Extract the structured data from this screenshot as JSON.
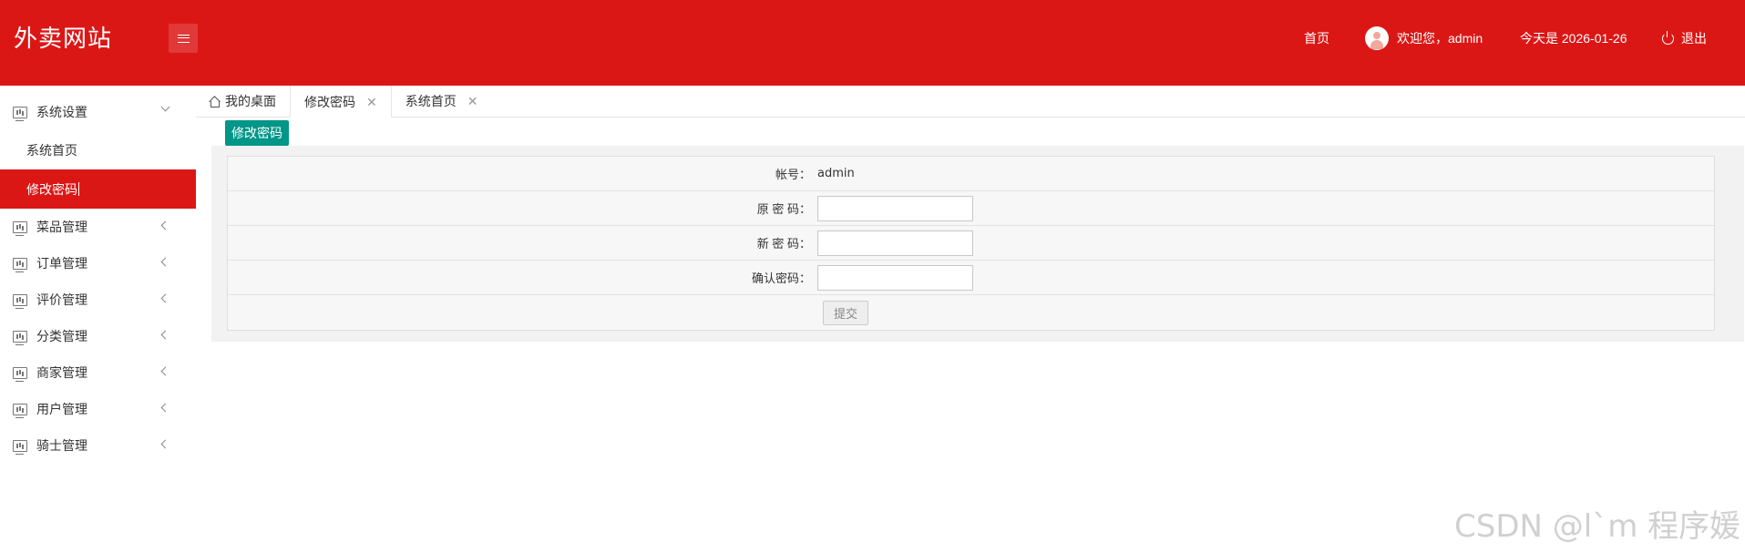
{
  "header": {
    "logo": "外卖网站",
    "nav_home": "首页",
    "welcome": "欢迎您，admin",
    "date_text": "今天是 2026-01-26",
    "logout": "退出"
  },
  "sidebar": {
    "items": [
      {
        "label": "系统设置",
        "expanded": true,
        "children": [
          "系统首页",
          "修改密码"
        ]
      },
      {
        "label": "菜品管理"
      },
      {
        "label": "订单管理"
      },
      {
        "label": "评价管理"
      },
      {
        "label": "分类管理"
      },
      {
        "label": "商家管理"
      },
      {
        "label": "用户管理"
      },
      {
        "label": "骑士管理"
      }
    ],
    "active_child": "修改密码"
  },
  "tabs": [
    {
      "label": "我的桌面",
      "closable": false
    },
    {
      "label": "修改密码",
      "closable": true,
      "active": true
    },
    {
      "label": "系统首页",
      "closable": true
    }
  ],
  "content": {
    "action_button": "修改密码",
    "form": {
      "account_label": "帐号：",
      "account_value": "admin",
      "old_password_label": "原 密 码：",
      "old_password_value": "",
      "new_password_label": "新 密 码：",
      "new_password_value": "",
      "confirm_password_label": "确认密码：",
      "confirm_password_value": "",
      "submit": "提交"
    }
  },
  "watermark": "CSDN @l`m 程序媛",
  "colors": {
    "header_bg": "#db1716",
    "active_menu_bg": "#db1716",
    "action_button_bg": "#009688"
  }
}
